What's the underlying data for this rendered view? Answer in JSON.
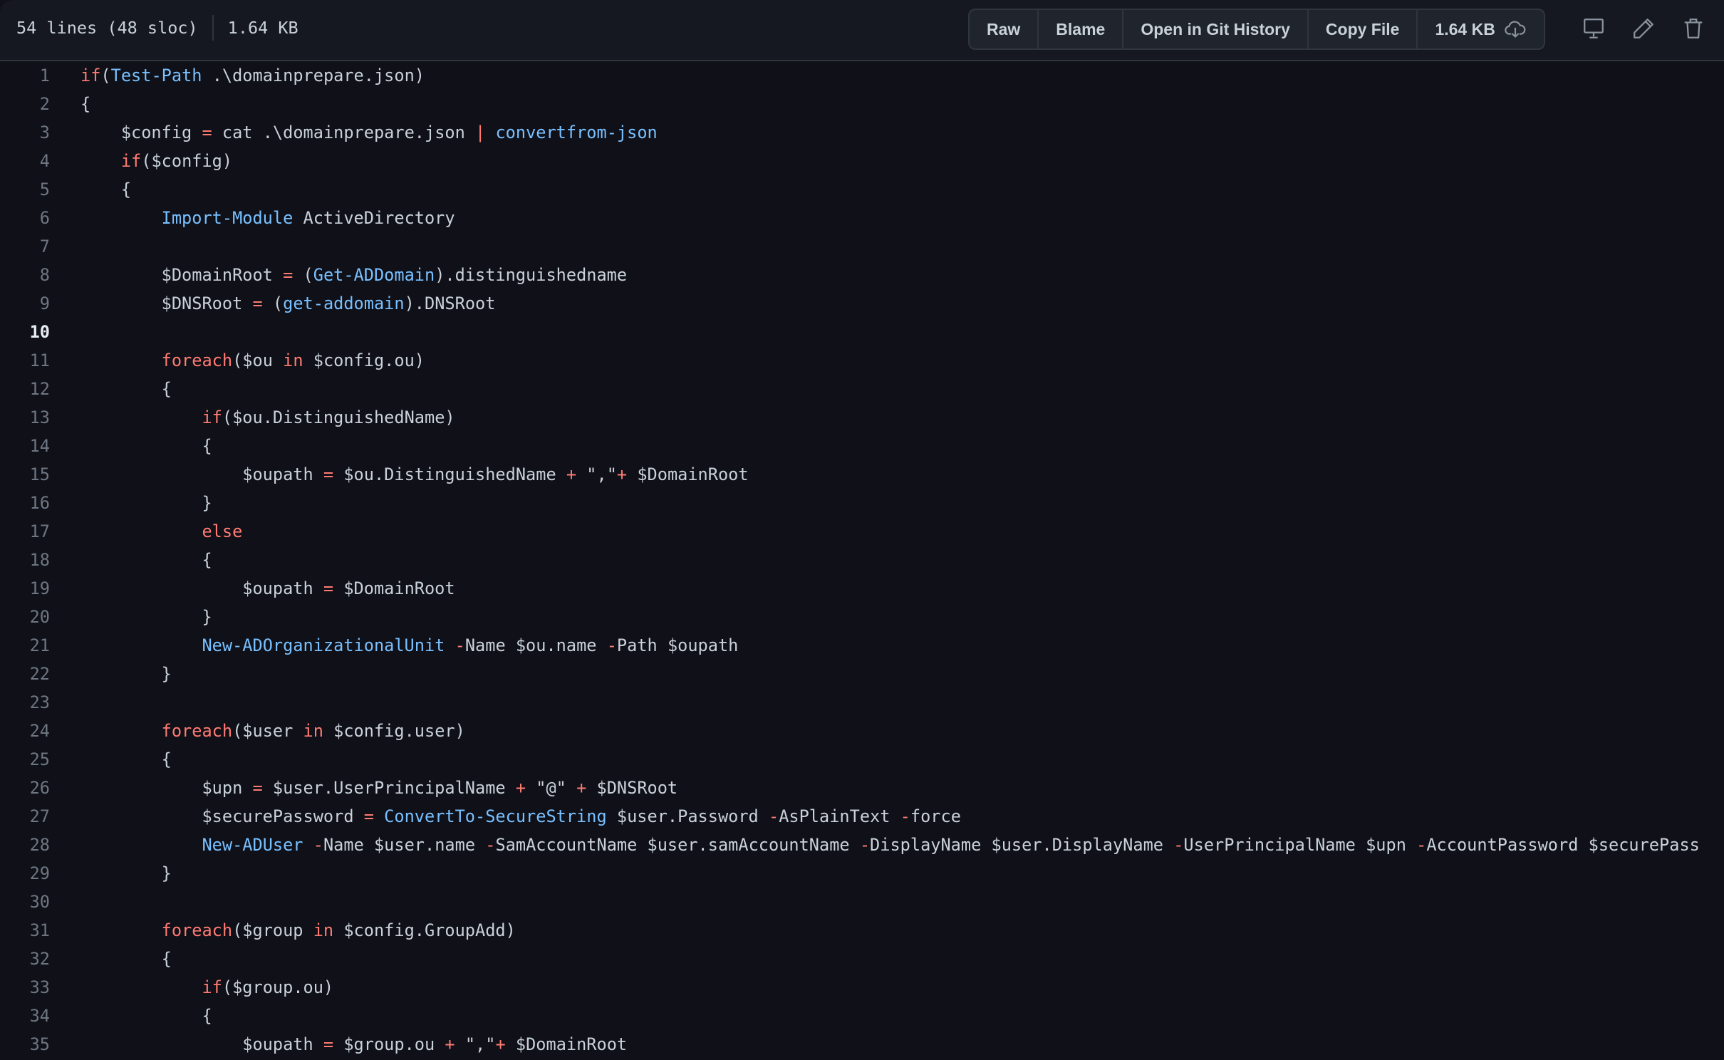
{
  "header": {
    "lines_info": "54 lines (48 sloc)",
    "size": "1.64 KB",
    "buttons": {
      "raw": "Raw",
      "blame": "Blame",
      "git_history": "Open in Git History",
      "copy_file": "Copy File",
      "download_size": "1.64 KB"
    },
    "icons": [
      "download-cloud-icon",
      "desktop-icon",
      "pencil-icon",
      "trash-icon"
    ]
  },
  "colors": {
    "keyword": "#ff7b72",
    "function": "#79c0ff",
    "text": "#c9d1d9",
    "background": "#0f1018"
  },
  "active_line": 10,
  "code": [
    [
      [
        "k",
        "if"
      ],
      [
        "p",
        "("
      ],
      [
        "f",
        "Test-Path"
      ],
      [
        "p",
        " .\\domainprepare.json)"
      ]
    ],
    [
      [
        "p",
        "{"
      ]
    ],
    [
      [
        "p",
        "    $config "
      ],
      [
        "o",
        "="
      ],
      [
        "p",
        " cat .\\domainprepare.json "
      ],
      [
        "o",
        "|"
      ],
      [
        "p",
        " "
      ],
      [
        "f",
        "convertfrom-json"
      ]
    ],
    [
      [
        "p",
        "    "
      ],
      [
        "k",
        "if"
      ],
      [
        "p",
        "($config)"
      ]
    ],
    [
      [
        "p",
        "    {"
      ]
    ],
    [
      [
        "p",
        "        "
      ],
      [
        "f",
        "Import-Module"
      ],
      [
        "p",
        " ActiveDirectory"
      ]
    ],
    [],
    [
      [
        "p",
        "        $DomainRoot "
      ],
      [
        "o",
        "="
      ],
      [
        "p",
        " ("
      ],
      [
        "f",
        "Get-ADDomain"
      ],
      [
        "p",
        ").distinguishedname"
      ]
    ],
    [
      [
        "p",
        "        $DNSRoot "
      ],
      [
        "o",
        "="
      ],
      [
        "p",
        " ("
      ],
      [
        "f",
        "get-addomain"
      ],
      [
        "p",
        ").DNSRoot"
      ]
    ],
    [],
    [
      [
        "p",
        "        "
      ],
      [
        "k",
        "foreach"
      ],
      [
        "p",
        "($ou "
      ],
      [
        "k",
        "in"
      ],
      [
        "p",
        " $config.ou)"
      ]
    ],
    [
      [
        "p",
        "        {"
      ]
    ],
    [
      [
        "p",
        "            "
      ],
      [
        "k",
        "if"
      ],
      [
        "p",
        "($ou.DistinguishedName)"
      ]
    ],
    [
      [
        "p",
        "            {"
      ]
    ],
    [
      [
        "p",
        "                $oupath "
      ],
      [
        "o",
        "="
      ],
      [
        "p",
        " $ou.DistinguishedName "
      ],
      [
        "o",
        "+"
      ],
      [
        "p",
        " \",\""
      ],
      [
        "o",
        "+"
      ],
      [
        "p",
        " $DomainRoot"
      ]
    ],
    [
      [
        "p",
        "            }"
      ]
    ],
    [
      [
        "p",
        "            "
      ],
      [
        "k",
        "else"
      ]
    ],
    [
      [
        "p",
        "            {"
      ]
    ],
    [
      [
        "p",
        "                $oupath "
      ],
      [
        "o",
        "="
      ],
      [
        "p",
        " $DomainRoot"
      ]
    ],
    [
      [
        "p",
        "            }"
      ]
    ],
    [
      [
        "p",
        "            "
      ],
      [
        "f",
        "New-ADOrganizationalUnit"
      ],
      [
        "p",
        " "
      ],
      [
        "o",
        "-"
      ],
      [
        "p",
        "Name $ou.name "
      ],
      [
        "o",
        "-"
      ],
      [
        "p",
        "Path $oupath"
      ]
    ],
    [
      [
        "p",
        "        }"
      ]
    ],
    [],
    [
      [
        "p",
        "        "
      ],
      [
        "k",
        "foreach"
      ],
      [
        "p",
        "($user "
      ],
      [
        "k",
        "in"
      ],
      [
        "p",
        " $config.user)"
      ]
    ],
    [
      [
        "p",
        "        {"
      ]
    ],
    [
      [
        "p",
        "            $upn "
      ],
      [
        "o",
        "="
      ],
      [
        "p",
        " $user.UserPrincipalName "
      ],
      [
        "o",
        "+"
      ],
      [
        "p",
        " \"@\" "
      ],
      [
        "o",
        "+"
      ],
      [
        "p",
        " $DNSRoot"
      ]
    ],
    [
      [
        "p",
        "            $securePassword "
      ],
      [
        "o",
        "="
      ],
      [
        "p",
        " "
      ],
      [
        "f",
        "ConvertTo-SecureString"
      ],
      [
        "p",
        " $user.Password "
      ],
      [
        "o",
        "-"
      ],
      [
        "p",
        "AsPlainText "
      ],
      [
        "o",
        "-"
      ],
      [
        "p",
        "force"
      ]
    ],
    [
      [
        "p",
        "            "
      ],
      [
        "f",
        "New-ADUser"
      ],
      [
        "p",
        " "
      ],
      [
        "o",
        "-"
      ],
      [
        "p",
        "Name $user.name "
      ],
      [
        "o",
        "-"
      ],
      [
        "p",
        "SamAccountName $user.samAccountName "
      ],
      [
        "o",
        "-"
      ],
      [
        "p",
        "DisplayName $user.DisplayName "
      ],
      [
        "o",
        "-"
      ],
      [
        "p",
        "UserPrincipalName $upn "
      ],
      [
        "o",
        "-"
      ],
      [
        "p",
        "AccountPassword $securePass"
      ]
    ],
    [
      [
        "p",
        "        }"
      ]
    ],
    [],
    [
      [
        "p",
        "        "
      ],
      [
        "k",
        "foreach"
      ],
      [
        "p",
        "($group "
      ],
      [
        "k",
        "in"
      ],
      [
        "p",
        " $config.GroupAdd)"
      ]
    ],
    [
      [
        "p",
        "        {"
      ]
    ],
    [
      [
        "p",
        "            "
      ],
      [
        "k",
        "if"
      ],
      [
        "p",
        "($group.ou)"
      ]
    ],
    [
      [
        "p",
        "            {"
      ]
    ],
    [
      [
        "p",
        "                $oupath "
      ],
      [
        "o",
        "="
      ],
      [
        "p",
        " $group.ou "
      ],
      [
        "o",
        "+"
      ],
      [
        "p",
        " \",\""
      ],
      [
        "o",
        "+"
      ],
      [
        "p",
        " $DomainRoot"
      ]
    ]
  ]
}
